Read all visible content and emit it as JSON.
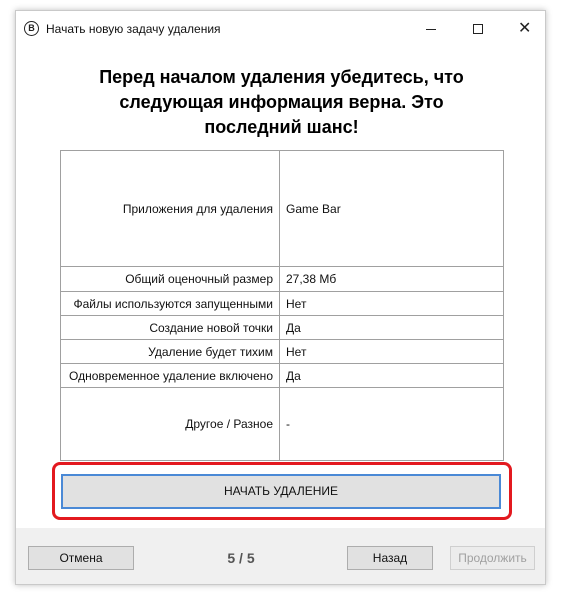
{
  "window": {
    "title": "Начать новую задачу удаления",
    "app_icon_glyph": "B",
    "controls": {
      "minimize": "minimize-icon",
      "maximize": "maximize-icon",
      "close": "close-icon"
    }
  },
  "heading": {
    "line1": "Перед началом удаления убедитесь, что",
    "line2": "следующая информация верна. Это",
    "line3": "последний шанс!"
  },
  "info_rows": [
    {
      "label": "Приложения для удаления",
      "value": "Game Bar"
    },
    {
      "label": "Общий оценочный размер",
      "value": "27,38 Мб"
    },
    {
      "label": "Файлы используются запущенными",
      "value": "Нет"
    },
    {
      "label": "Создание новой точки",
      "value": "Да"
    },
    {
      "label": "Удаление будет тихим",
      "value": "Нет"
    },
    {
      "label": "Одновременное удаление включено",
      "value": "Да"
    },
    {
      "label": "Другое / Разное",
      "value": "-"
    }
  ],
  "start_button": {
    "label": "НАЧАТЬ УДАЛЕНИЕ"
  },
  "footer": {
    "cancel_label": "Отмена",
    "page_indicator": "5 / 5",
    "back_label": "Назад",
    "next_label": "Продолжить"
  },
  "colors": {
    "highlight": "#e3191f",
    "focus_border": "#4a89d6",
    "footer_bg": "#f0f0f0"
  }
}
